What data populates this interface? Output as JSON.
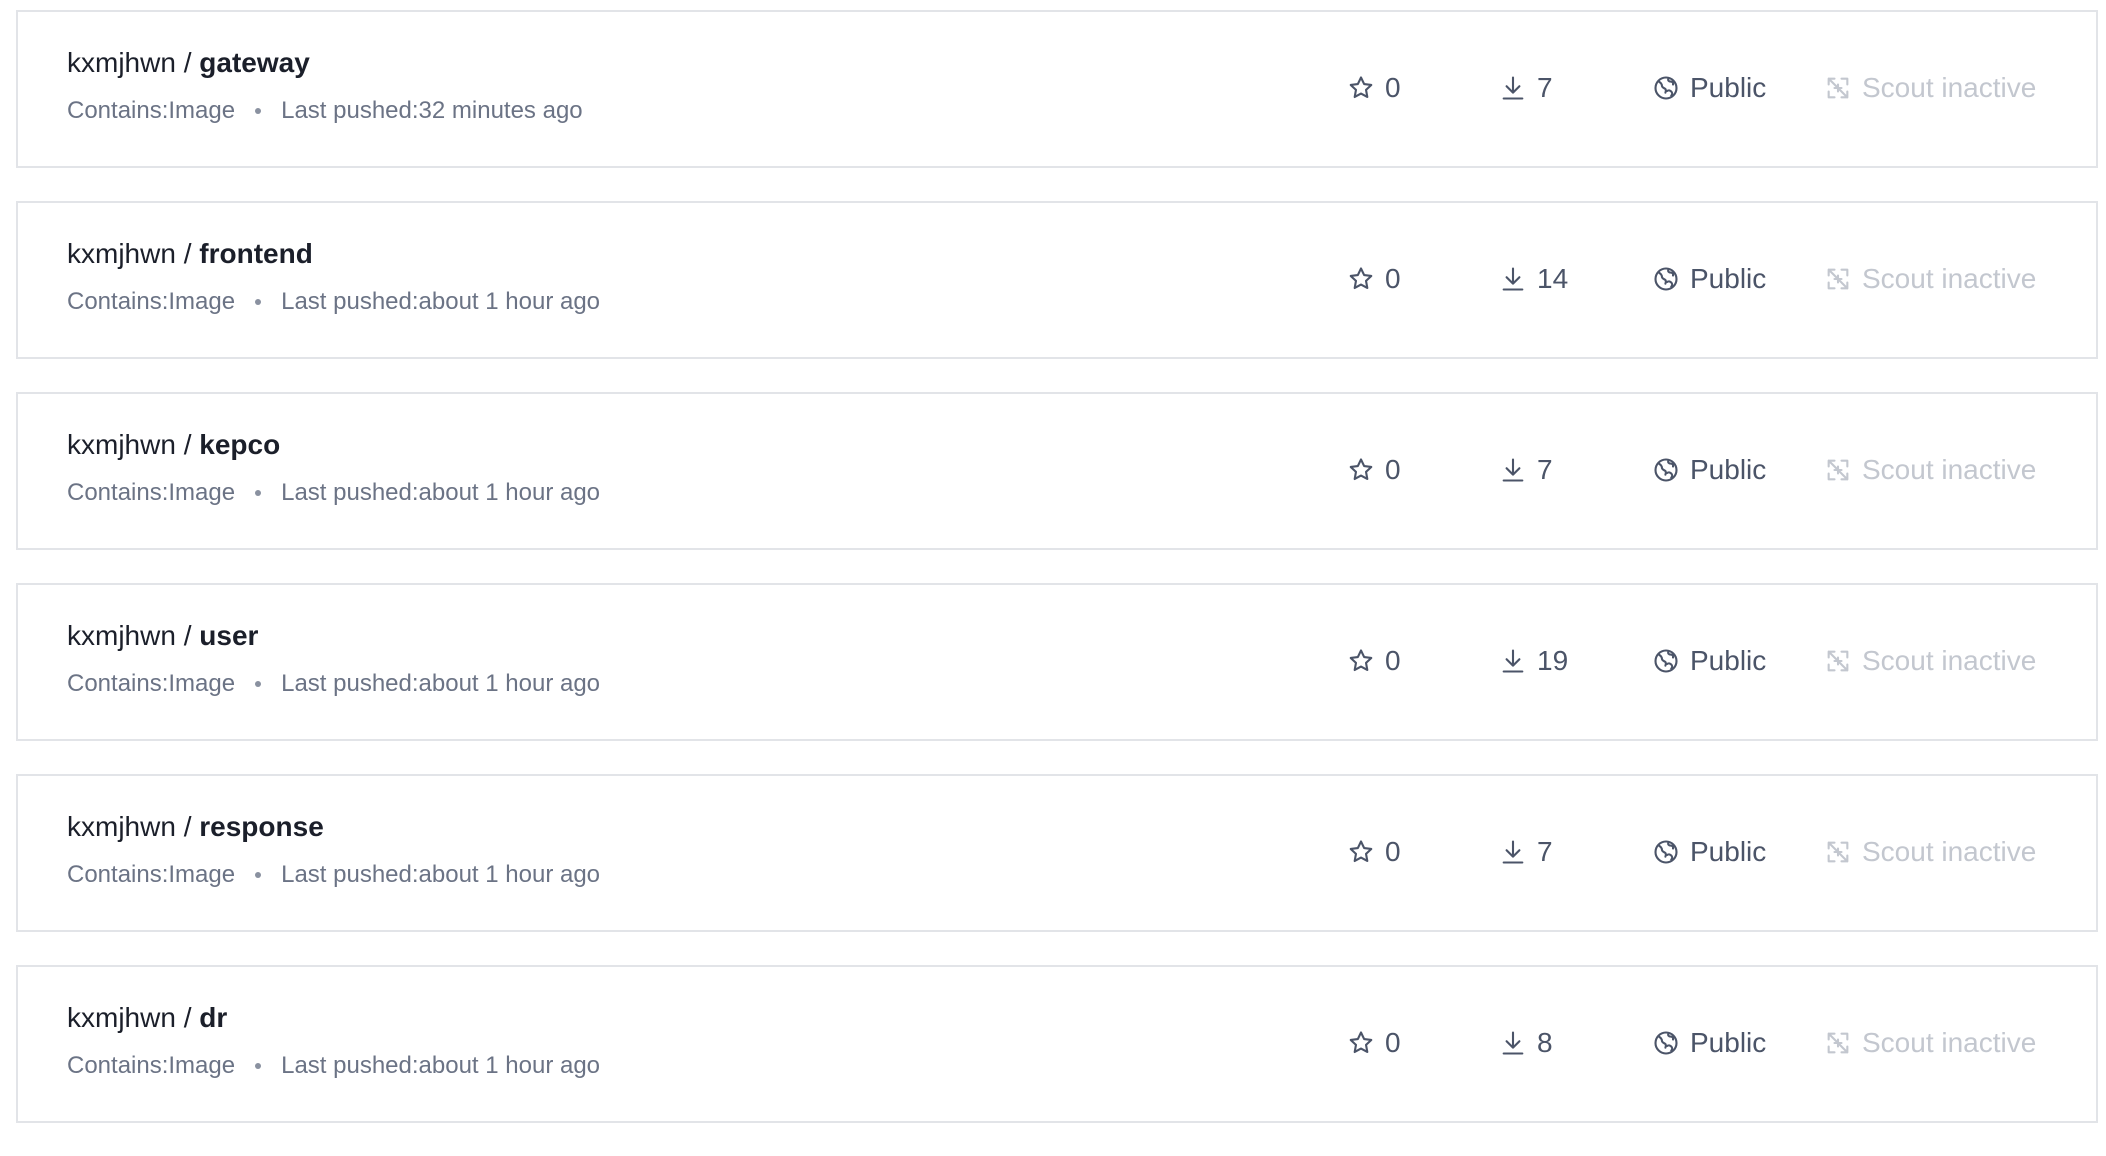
{
  "labels": {
    "separator": " / ",
    "contains_prefix": "Contains: ",
    "pushed_prefix": "Last pushed: "
  },
  "repositories": [
    {
      "namespace": "kxmjhwn",
      "name": "gateway",
      "contains": "Image",
      "last_pushed": "32 minutes ago",
      "stars": "0",
      "pulls": "7",
      "visibility": "Public",
      "scout_status": "Scout inactive"
    },
    {
      "namespace": "kxmjhwn",
      "name": "frontend",
      "contains": "Image",
      "last_pushed": "about 1 hour ago",
      "stars": "0",
      "pulls": "14",
      "visibility": "Public",
      "scout_status": "Scout inactive"
    },
    {
      "namespace": "kxmjhwn",
      "name": "kepco",
      "contains": "Image",
      "last_pushed": "about 1 hour ago",
      "stars": "0",
      "pulls": "7",
      "visibility": "Public",
      "scout_status": "Scout inactive"
    },
    {
      "namespace": "kxmjhwn",
      "name": "user",
      "contains": "Image",
      "last_pushed": "about 1 hour ago",
      "stars": "0",
      "pulls": "19",
      "visibility": "Public",
      "scout_status": "Scout inactive"
    },
    {
      "namespace": "kxmjhwn",
      "name": "response",
      "contains": "Image",
      "last_pushed": "about 1 hour ago",
      "stars": "0",
      "pulls": "7",
      "visibility": "Public",
      "scout_status": "Scout inactive"
    },
    {
      "namespace": "kxmjhwn",
      "name": "dr",
      "contains": "Image",
      "last_pushed": "about 1 hour ago",
      "stars": "0",
      "pulls": "8",
      "visibility": "Public",
      "scout_status": "Scout inactive"
    }
  ],
  "icons": {
    "stars": "star-icon",
    "pulls": "download-icon",
    "visibility": "globe-icon",
    "scout": "scout-off-icon"
  },
  "colors": {
    "title_text": "#1b1f2a",
    "meta_text": "#6b7385",
    "stat_text": "#4b5468",
    "scout_inactive_text": "#c3c7cf",
    "card_border": "#e2e4e8"
  }
}
